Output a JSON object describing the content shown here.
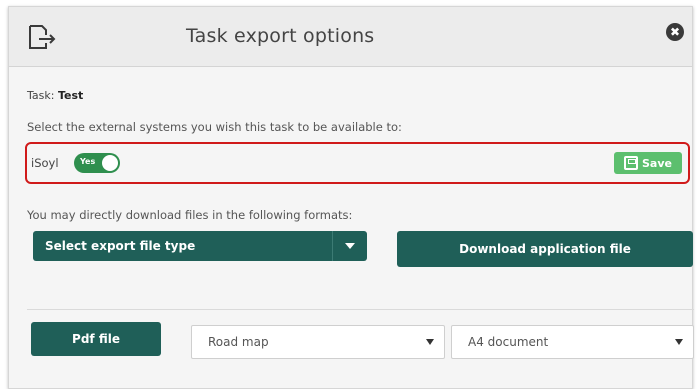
{
  "dialog": {
    "title": "Task export options",
    "close_label": "✖"
  },
  "task": {
    "label": "Task: ",
    "name": "Test"
  },
  "external": {
    "prompt": "Select the external systems you wish this task to be available to:",
    "system_name": "iSoyl",
    "toggle_text": "Yes",
    "toggle_on": true,
    "save_label": "Save"
  },
  "download": {
    "prompt": "You may directly download files in the following formats:",
    "select_placeholder": "Select export file type",
    "download_app_label": "Download application file"
  },
  "pdf": {
    "button_label": "Pdf file",
    "template_selected": "Road map",
    "format_selected": "A4 document"
  },
  "colors": {
    "primary": "#1f5f58",
    "toggle_on": "#2f8f4e",
    "save": "#5cbf6e",
    "highlight": "#d01a1a"
  },
  "icons": {
    "header": "export-icon",
    "close": "close-icon",
    "save": "save-icon",
    "dropdown": "chevron-down-icon"
  }
}
